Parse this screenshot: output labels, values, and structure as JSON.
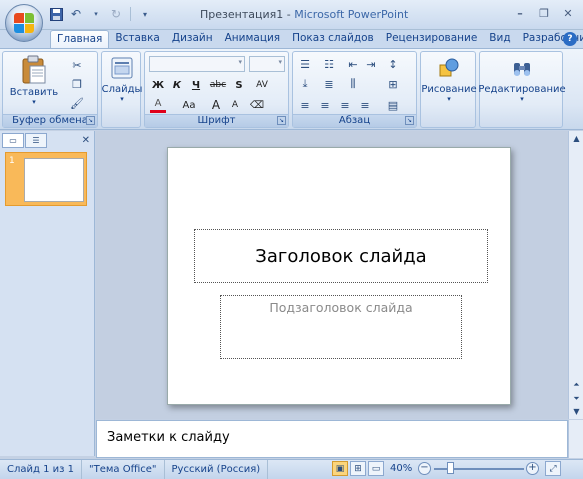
{
  "window": {
    "title_doc": "Презентация1",
    "title_sep": " - ",
    "title_app": "Microsoft PowerPoint"
  },
  "tabs": [
    {
      "label": "Главная",
      "active": true
    },
    {
      "label": "Вставка"
    },
    {
      "label": "Дизайн"
    },
    {
      "label": "Анимация"
    },
    {
      "label": "Показ слайдов"
    },
    {
      "label": "Рецензирование"
    },
    {
      "label": "Вид"
    },
    {
      "label": "Разработчик"
    }
  ],
  "ribbon": {
    "clipboard": {
      "label": "Буфер обмена",
      "paste": "Вставить"
    },
    "slides": {
      "label": "Слайды"
    },
    "font": {
      "label": "Шрифт",
      "bold": "Ж",
      "italic": "К",
      "underline": "Ч",
      "strike": "abc",
      "shadow": "S",
      "spacing": "AV",
      "color": "A",
      "case": "Aa",
      "grow": "A",
      "shrink": "A"
    },
    "paragraph": {
      "label": "Абзац"
    },
    "drawing": {
      "label": "Рисование"
    },
    "editing": {
      "label": "Редактирование"
    }
  },
  "slide_panel": {
    "slide_number": "1"
  },
  "slide": {
    "title": "Заголовок слайда",
    "subtitle": "Подзаголовок слайда"
  },
  "notes": {
    "placeholder": "Заметки к слайду"
  },
  "status": {
    "slide": "Слайд 1 из 1",
    "theme": "\"Тема Office\"",
    "language": "Русский (Россия)",
    "zoom": "40%"
  }
}
